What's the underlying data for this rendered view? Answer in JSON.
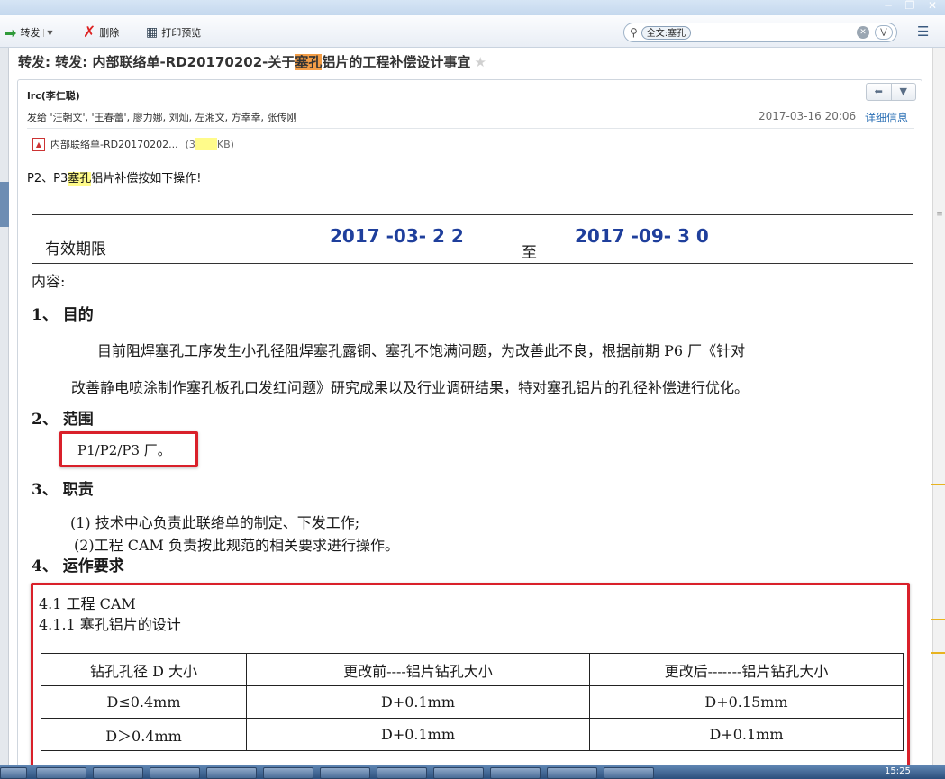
{
  "toolbar": {
    "forward": "转发",
    "delete": "删除",
    "print": "打印预览"
  },
  "search": {
    "tag": "全文:塞孔"
  },
  "subject": {
    "pre": "转发: 转发: 内部联络单-RD20170202-关于",
    "hl": "塞孔",
    "post": "铝片的工程补偿设计事宜"
  },
  "mail": {
    "sender": "lrc(李仁聪)",
    "recipients": "发给 '汪朝文', '王春蕾', 廖力娜, 刘灿, 左湘文, 方幸幸, 张传刚",
    "date": "2017-03-16 20:06",
    "details": "详细信息",
    "attachment": {
      "name": "内部联络单-RD20170202...",
      "size_open": "(3",
      "size_close": "KB)"
    },
    "greeting": {
      "pre": "P2、P3",
      "hl": "塞孔",
      "post": "铝片补偿按如下操作!"
    }
  },
  "doc": {
    "validity_label": "有效期限",
    "validity_start": "2017 -03- 2 2",
    "validity_to": "至",
    "validity_end": "2017 -09- 3 0",
    "content_label": "内容:",
    "s1_title": "1、 目的",
    "s1_line1": "目前阻焊塞孔工序发生小孔径阻焊塞孔露铜、塞孔不饱满问题，为改善此不良，根据前期 P6 厂《针对",
    "s1_line2": "改善静电喷涂制作塞孔板孔口发红问题》研究成果以及行业调研结果，特对塞孔铝片的孔径补偿进行优化。",
    "s2_title": "2、 范围",
    "s2_scope": "P1/P2/P3 厂。",
    "s3_title": "3、 职责",
    "s3_line1": "(1) 技术中心负责此联络单的制定、下发工作;",
    "s3_line2": "(2)工程 CAM 负责按此规范的相关要求进行操作。",
    "s4_title": "4、 运作要求",
    "s41": "4.1 工程 CAM",
    "s411": "4.1.1 塞孔铝片的设计",
    "table": {
      "headers": [
        "钻孔孔径 D 大小",
        "更改前----铝片钻孔大小",
        "更改后-------铝片钻孔大小"
      ],
      "rows": [
        [
          "D≤0.4mm",
          "D+0.1mm",
          "D+0.15mm"
        ],
        [
          "D＞0.4mm",
          "D+0.1mm",
          "D+0.1mm"
        ]
      ]
    }
  },
  "clock": "15:25"
}
